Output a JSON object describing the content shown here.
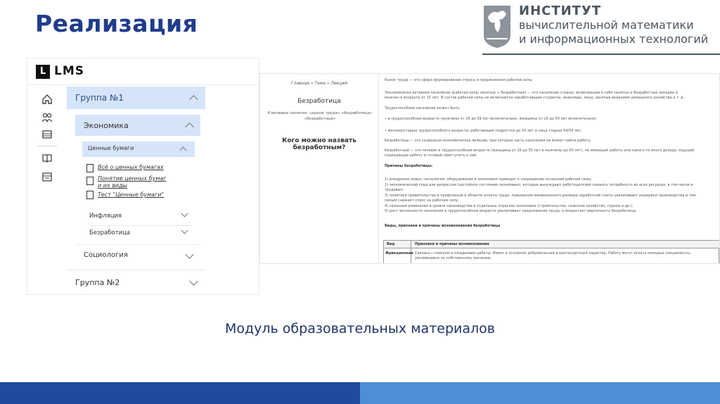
{
  "slide": {
    "title": "Реализация",
    "caption": "Модуль образовательных материалов"
  },
  "logo": {
    "line1": "ИНСТИТУТ",
    "line2": "вычислительной математики",
    "line3": "и информационных технологий",
    "color": "#4a5560"
  },
  "lms": {
    "app_name": "LMS",
    "logo_letter": "L",
    "rail_icons": [
      "home-icon",
      "users-icon",
      "table-icon",
      "book-icon",
      "calendar-icon"
    ],
    "group1": "Группа №1",
    "subject": "Экономика",
    "topic": "Ценные бумаги",
    "materials": [
      "Всё о ценных бумагах",
      "Понятие ценных бумаг и их виды",
      "Тест \"Ценные бумаги\""
    ],
    "material_icons": [
      "document-icon",
      "list-icon",
      "checklist-icon"
    ],
    "topic_inflation": "Инфляция",
    "topic_unemployment": "Безработица",
    "subject2": "Социология",
    "group2": "Группа №2",
    "accent": "#d6e4fa"
  },
  "lecture": {
    "crumbs": "Главная  »  Тема  »  Лекция",
    "title": "Безработица",
    "key_concepts": "Ключевые понятия: «рынок труда» «безработица» «безработный»",
    "question": "Кого можно назвать безработным?",
    "lines": [
      {
        "t": "Рынок труда — это сфера формирования спроса и предложения рабочей силы.",
        "b": false
      },
      {
        "t": "Экономически активное население (рабочая сила: занятые + безработные) — это население страны, включающее в себя занятых и безработных женщин и",
        "b": false
      },
      {
        "t": "мужчин в возрасте от 15 лет. В состав рабочей силы не включаются неработающие студенты, инвалиды, лица, занятые ведением домашнего хозяйства и т. д.",
        "b": false
      },
      {
        "t": "Трудоспособное население может быть:",
        "b": false
      },
      {
        "t": "• в трудоспособном возрасте (мужчины от 16 до 59 лет включительно, женщины от 16 до 54 лет включительно)",
        "b": false
      },
      {
        "t": "• моложе/старше трудоспособного возраста: работающие подростки до 16 лет и лица старше 54/59 лет.",
        "b": false
      },
      {
        "t": "Безработица — это социально-экономическое явление, при котором часть населения не может найти работу.",
        "b": false
      },
      {
        "t": "Безработный — это человек в трудоспособном возрасте (женщины от 16 до 55 лет и мужчины до 60 лет), не имеющий работы или какого-то иного дохода, ищущий",
        "b": false
      },
      {
        "t": "подходящую работу и готовый приступить к ней.",
        "b": false
      },
      {
        "t": "Причины безработицы:",
        "b": true
      },
      {
        "t": "1) внедрение новых технологий, оборудования в экономики приводит к сокращению излишней рабочей силы;",
        "b": false
      },
      {
        "t": "2) экономический спад или депрессия (застойное состояние экономики), которые вынуждают работодателей снижать потребность во всех ресурсах, в том числе и",
        "b": false
      },
      {
        "t": "трудовых;",
        "b": false
      },
      {
        "t": "3) политика правительства и профсоюзов в области оплаты труда: повышение минимального размера заработной платы увеличивает издержки производства и тем",
        "b": false
      },
      {
        "t": "самым снижает спрос на рабочую силу;",
        "b": false
      },
      {
        "t": "4) сезонные изменения в уровне производства в отдельных отраслях экономики (строительство, сельское хозяйство, туризм и др.);",
        "b": false
      },
      {
        "t": "5) рост численности населения в трудоспособном возрасте увеличивает предложение труда, и возрастает вероятность безработицы.",
        "b": false
      },
      {
        "t": "Виды, признаки и причины возникновения безработицы",
        "b": true
      }
    ],
    "table_head": [
      "Вид",
      "Признаки и причины возникновения"
    ],
    "table_row_label": "Фрикционная",
    "table_row_text1": "Связана с поиском и ожиданием работы. Имеет в основном добровольный и краткосрочный характер. Работу могут искать молодые специалисты,",
    "table_row_text2": "уволившиеся по собственному желанию."
  },
  "footer": {
    "color_left": "#1f4a9e",
    "color_right": "#4d8fd6"
  }
}
